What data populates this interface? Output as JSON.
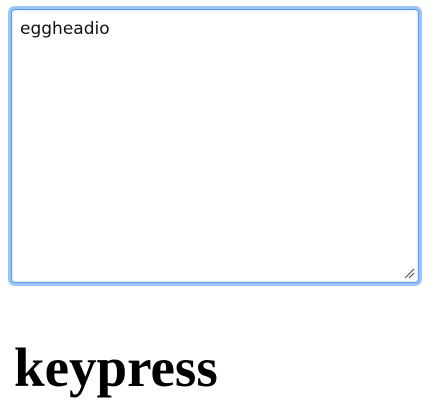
{
  "textarea": {
    "value": "eggheadio"
  },
  "heading": {
    "text": "keypress"
  },
  "colors": {
    "focus_ring": "#9cc4f6",
    "focus_border": "#5b9cf0",
    "text": "#111111",
    "heading": "#000000"
  },
  "icons": {
    "resize_grip": "resize-grip-icon"
  }
}
